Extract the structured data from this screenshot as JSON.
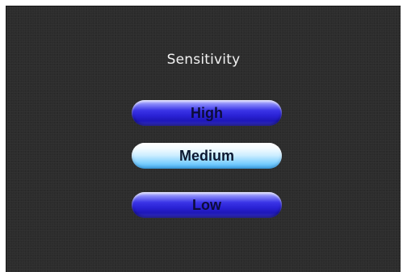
{
  "menu": {
    "title": "Sensitivity",
    "options": [
      {
        "label": "High",
        "selected": false
      },
      {
        "label": "Medium",
        "selected": true
      },
      {
        "label": "Low",
        "selected": false
      }
    ]
  },
  "colors": {
    "background": "#2c2c2c",
    "unselected_button": "#2a22d6",
    "selected_button": "#cdeeff",
    "title_text": "#f2f2f2"
  }
}
